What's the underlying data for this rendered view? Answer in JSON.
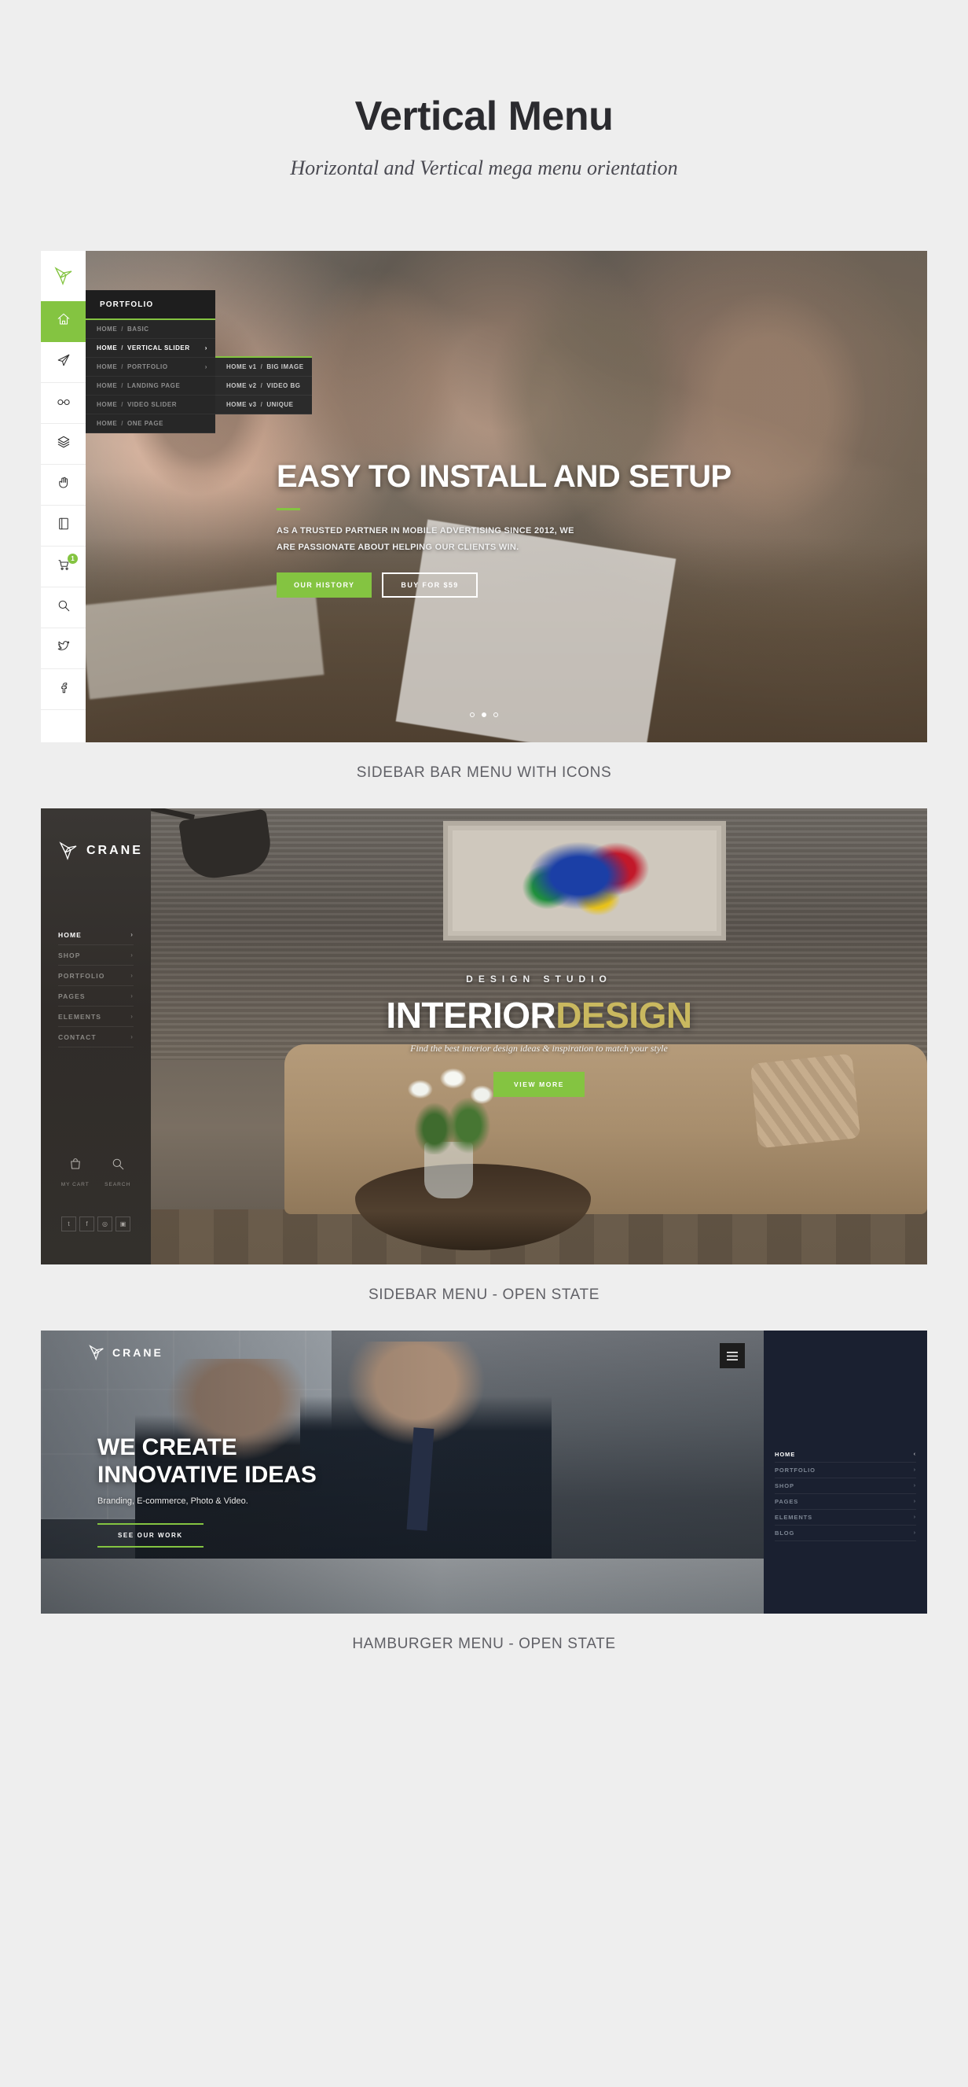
{
  "header": {
    "title": "Vertical Menu",
    "subtitle": "Horizontal and Vertical mega menu orientation"
  },
  "colors": {
    "accent_green": "#84c441",
    "page_bg": "#eeeeee",
    "dark_panel": "#232323",
    "caption_text": "#606066"
  },
  "shot1": {
    "caption": "SIDEBAR BAR MENU WITH ICONS",
    "rail": {
      "logo_icon": "origami-bird-logo-icon",
      "items": [
        {
          "icon": "home-icon",
          "active": true
        },
        {
          "icon": "paper-plane-icon",
          "active": false
        },
        {
          "icon": "glasses-icon",
          "active": false
        },
        {
          "icon": "layers-icon",
          "active": false
        },
        {
          "icon": "hand-icon",
          "active": false
        },
        {
          "icon": "book-icon",
          "active": false
        },
        {
          "icon": "cart-icon",
          "active": false,
          "badge": "1"
        },
        {
          "icon": "search-icon",
          "active": false
        },
        {
          "icon": "twitter-icon",
          "active": false
        },
        {
          "icon": "facebook-icon",
          "active": false
        }
      ]
    },
    "mega": {
      "heading": "PORTFOLIO",
      "items": [
        {
          "prefix": "HOME",
          "label": "BASIC",
          "active": false,
          "has_arrow": false
        },
        {
          "prefix": "HOME",
          "label": "VERTICAL SLIDER",
          "active": true,
          "has_arrow": true
        },
        {
          "prefix": "HOME",
          "label": "PORTFOLIO",
          "active": false,
          "has_arrow": true
        },
        {
          "prefix": "HOME",
          "label": "LANDING PAGE",
          "active": false,
          "has_arrow": false
        },
        {
          "prefix": "HOME",
          "label": "VIDEO SLIDER",
          "active": false,
          "has_arrow": false
        },
        {
          "prefix": "HOME",
          "label": "ONE PAGE",
          "active": false,
          "has_arrow": false
        }
      ]
    },
    "submega": {
      "items": [
        {
          "prefix": "HOME v1",
          "label": "BIG IMAGE"
        },
        {
          "prefix": "HOME v2",
          "label": "VIDEO BG"
        },
        {
          "prefix": "HOME v3",
          "label": "UNIQUE"
        }
      ]
    },
    "hero": {
      "title": "EASY TO INSTALL AND SETUP",
      "subtitle": "AS A TRUSTED PARTNER IN MOBILE ADVERTISING SINCE 2012, WE ARE PASSIONATE ABOUT HELPING OUR CLIENTS WIN.",
      "btn_primary": "OUR HISTORY",
      "btn_secondary": "BUY FOR $59",
      "slider_dots": 3,
      "slider_active_index": 1
    }
  },
  "shot2": {
    "caption": "SIDEBAR MENU - OPEN STATE",
    "brand": "CRANE",
    "brand_icon": "origami-bird-logo-icon",
    "nav": [
      {
        "label": "HOME",
        "active": true,
        "has_chevron": true
      },
      {
        "label": "SHOP",
        "active": false,
        "has_chevron": true
      },
      {
        "label": "PORTFOLIO",
        "active": false,
        "has_chevron": true
      },
      {
        "label": "PAGES",
        "active": false,
        "has_chevron": true
      },
      {
        "label": "ELEMENTS",
        "active": false,
        "has_chevron": true
      },
      {
        "label": "CONTACT",
        "active": false,
        "has_chevron": true
      }
    ],
    "tools": [
      {
        "icon": "shopping-bag-icon",
        "label": "MY CART"
      },
      {
        "icon": "search-icon",
        "label": "SEARCH"
      }
    ],
    "social": [
      {
        "icon": "twitter-icon",
        "glyph": "t"
      },
      {
        "icon": "facebook-icon",
        "glyph": "f"
      },
      {
        "icon": "dribbble-icon",
        "glyph": "◎"
      },
      {
        "icon": "instagram-icon",
        "glyph": "▣"
      }
    ],
    "hero": {
      "kicker": "DESIGN STUDIO",
      "title_part1": "INTERIOR",
      "title_part2": "DESIGN",
      "subtitle": "Find the best interior design ideas & inspiration to match your style",
      "button": "VIEW MORE"
    }
  },
  "shot3": {
    "caption": "HAMBURGER MENU - OPEN STATE",
    "brand": "CRANE",
    "brand_icon": "origami-bird-logo-icon",
    "hamburger_icon": "hamburger-menu-icon",
    "hero": {
      "title_line1": "WE CREATE",
      "title_line2": "INNOVATIVE IDEAS",
      "subtitle": "Branding, E-commerce, Photo & Video.",
      "button": "SEE OUR WORK"
    },
    "nav": [
      {
        "label": "HOME",
        "active": true,
        "chevron": "‹"
      },
      {
        "label": "PORTFOLIO",
        "active": false,
        "chevron": "›"
      },
      {
        "label": "SHOP",
        "active": false,
        "chevron": "›"
      },
      {
        "label": "PAGES",
        "active": false,
        "chevron": "›"
      },
      {
        "label": "ELEMENTS",
        "active": false,
        "chevron": "›"
      },
      {
        "label": "BLOG",
        "active": false,
        "chevron": "›"
      }
    ]
  }
}
